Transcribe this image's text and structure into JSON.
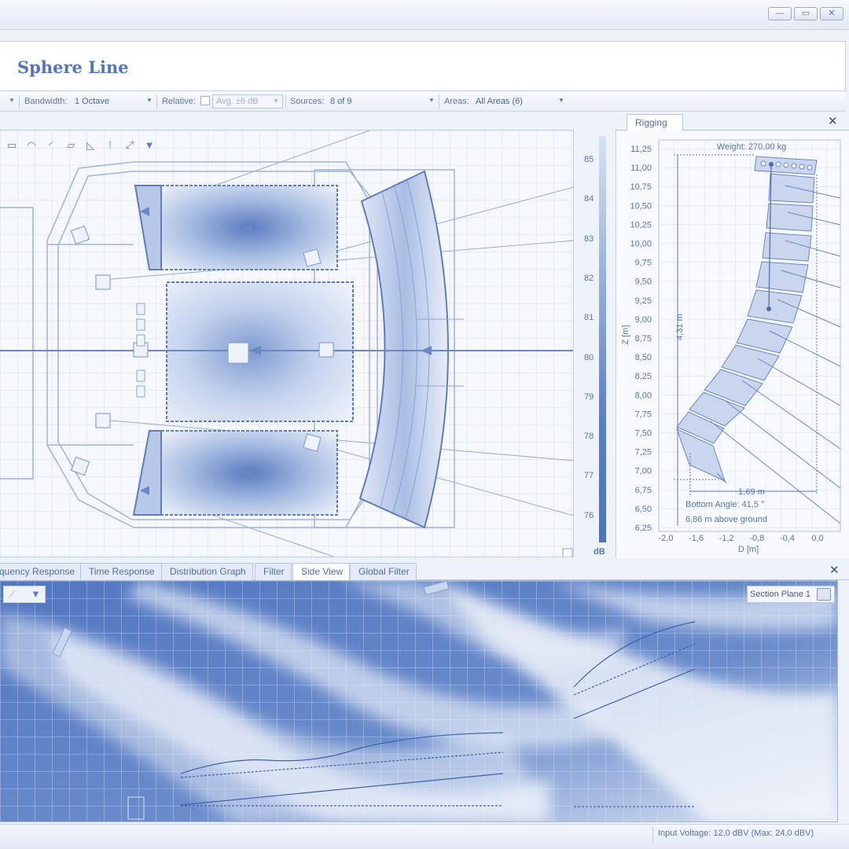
{
  "window": {
    "minimize_icon": "minimize-icon",
    "maximize_icon": "maximize-icon",
    "close_icon": "close-icon"
  },
  "header": {
    "title": "Sphere Line"
  },
  "toolbar": {
    "bandwidth_label": "Bandwidth:",
    "bandwidth_value": "1 Octave",
    "relative_label": "Relative:",
    "relative_checked": false,
    "avg_value": "Avg. ±6 dB",
    "sources_label": "Sources:",
    "sources_value": "8 of 9",
    "areas_label": "Areas:",
    "areas_value": "All Areas (6)"
  },
  "plan": {
    "tool_icons": [
      "rect-area-icon",
      "arc-area-icon",
      "curve-area-icon",
      "trapezoid-area-icon",
      "corner-area-icon",
      "line-array-icon",
      "measure-icon",
      "speaker-icon"
    ],
    "scale": {
      "ticks": [
        "85",
        "84",
        "83",
        "82",
        "81",
        "80",
        "79",
        "78",
        "77",
        "76"
      ],
      "unit": "dB"
    }
  },
  "rigging": {
    "tab": "Rigging",
    "weight": "Weight: 270,00 kg",
    "height_dim": "4,31 m",
    "width_dim": "1,69 m",
    "bottom_angle": "Bottom Angle: 41,5 °",
    "above_ground": "6,86 m above ground",
    "y_axis_label": "Z [m]",
    "x_axis_label": "D [m]",
    "y_ticks": [
      "11,25",
      "11,00",
      "10,75",
      "10,50",
      "10,25",
      "10,00",
      "9,75",
      "9,50",
      "9,25",
      "9,00",
      "8,75",
      "8,50",
      "8,25",
      "8,00",
      "7,75",
      "7,50",
      "7,25",
      "7,00",
      "6,75",
      "6,50",
      "6,25"
    ],
    "x_ticks": [
      "-2,0",
      "-1,6",
      "-1,2",
      "-0,8",
      "-0,4",
      "0,0"
    ]
  },
  "bottom_tabs": [
    "quency Response",
    "Time Response",
    "Distribution Graph",
    "Filter",
    "Side View",
    "Global Filter"
  ],
  "active_bottom_tab": "Side View",
  "side_view": {
    "section_label": "Section Plane 1"
  },
  "status": {
    "input_voltage": "Input Voltage: 12,0 dBV (Max: 24,0 dBV)"
  }
}
